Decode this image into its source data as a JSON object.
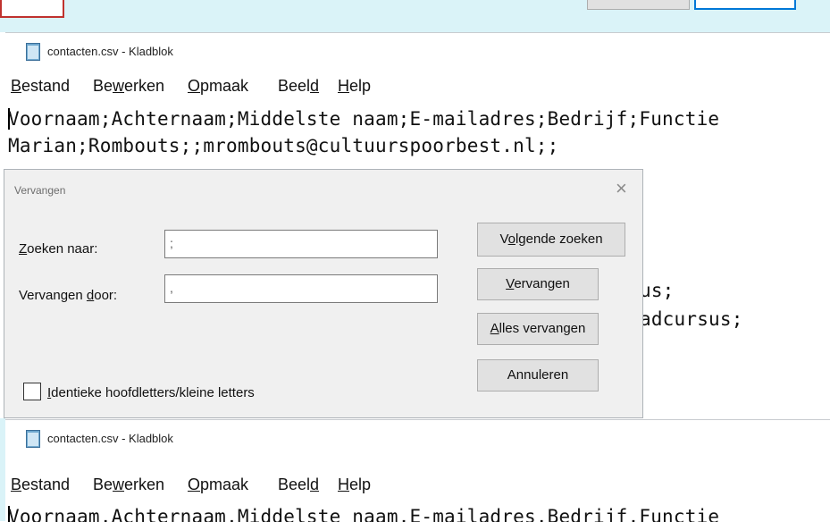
{
  "window1": {
    "title": "contacten.csv - Kladblok",
    "menu": [
      "Bestand",
      "Bewerken",
      "Opmaak",
      "Beeld",
      "Help"
    ],
    "lines": [
      "Voornaam;Achternaam;Middelste naam;E-mailadres;Bedrijf;Functie",
      "Marian;Rombouts;;mrombouts@cultuurspoorbest.nl;;"
    ],
    "partial_lines": [
      "us;",
      "adcursus;"
    ]
  },
  "dialog": {
    "title": "Vervangen",
    "close_glyph": "×",
    "find_label": "Zoeken naar:",
    "find_value": ";",
    "replace_label": "Vervangen door:",
    "replace_value": ",",
    "buttons": {
      "find_next": "Volgende zoeken",
      "replace": "Vervangen",
      "replace_all": "Alles vervangen",
      "cancel": "Annuleren"
    },
    "match_case_label": "Identieke hoofdletters/kleine letters",
    "match_case_checked": false
  },
  "window2": {
    "title": "contacten.csv - Kladblok",
    "menu": [
      "Bestand",
      "Bewerken",
      "Opmaak",
      "Beeld",
      "Help"
    ],
    "lines": [
      "Voornaam,Achternaam,Middelste naam,E-mailadres,Bedrijf,Functie"
    ]
  },
  "colors": {
    "strip": "#daf3f8",
    "dialog_bg": "#f0f0f0",
    "accent_border": "#0078d7",
    "red_border": "#c0322e"
  },
  "icons": {
    "app": "notepad-icon",
    "close": "close-icon",
    "checkbox": "checkbox-icon"
  }
}
